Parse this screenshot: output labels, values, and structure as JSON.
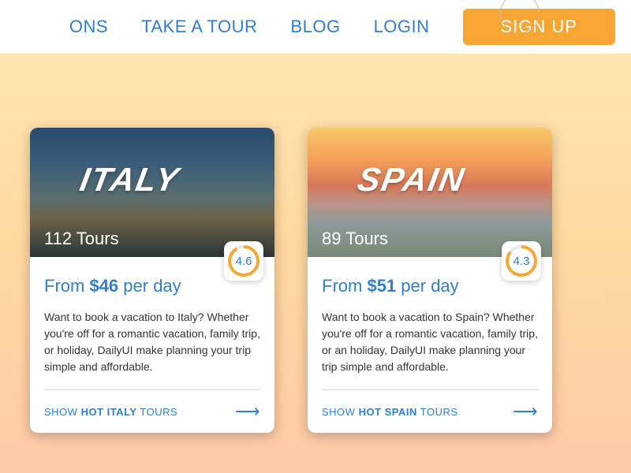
{
  "nav": {
    "item0": "ONS",
    "item1": "TAKE A TOUR",
    "item2": "BLOG",
    "item3": "LOGIN",
    "signup": "SIGN UP"
  },
  "cards": [
    {
      "name": "ITALY",
      "tours_count": "112",
      "tours_label": "Tours",
      "rating": "4.6",
      "price_prefix": "From ",
      "price_amount": "$46",
      "price_suffix": " per day",
      "desc": "Want to book a vacation to Italy? Whether you're off for a romantic vacation, family trip, or holiday, DailyUI make planning your trip simple and affordable.",
      "link_prefix": "SHOW ",
      "link_hot": "HOT ITALY",
      "link_suffix": " TOURS"
    },
    {
      "name": "SPAIN",
      "tours_count": "89",
      "tours_label": "Tours",
      "rating": "4.3",
      "price_prefix": "From ",
      "price_amount": "$51",
      "price_suffix": " per day",
      "desc": "Want to book a vacation to Spain? Whether you're off for a romantic vacation, family trip, or an holiday, DailyUI make planning your trip simple and affordable.",
      "link_prefix": "SHOW ",
      "link_hot": "HOT SPAIN",
      "link_suffix": " TOURS"
    }
  ]
}
